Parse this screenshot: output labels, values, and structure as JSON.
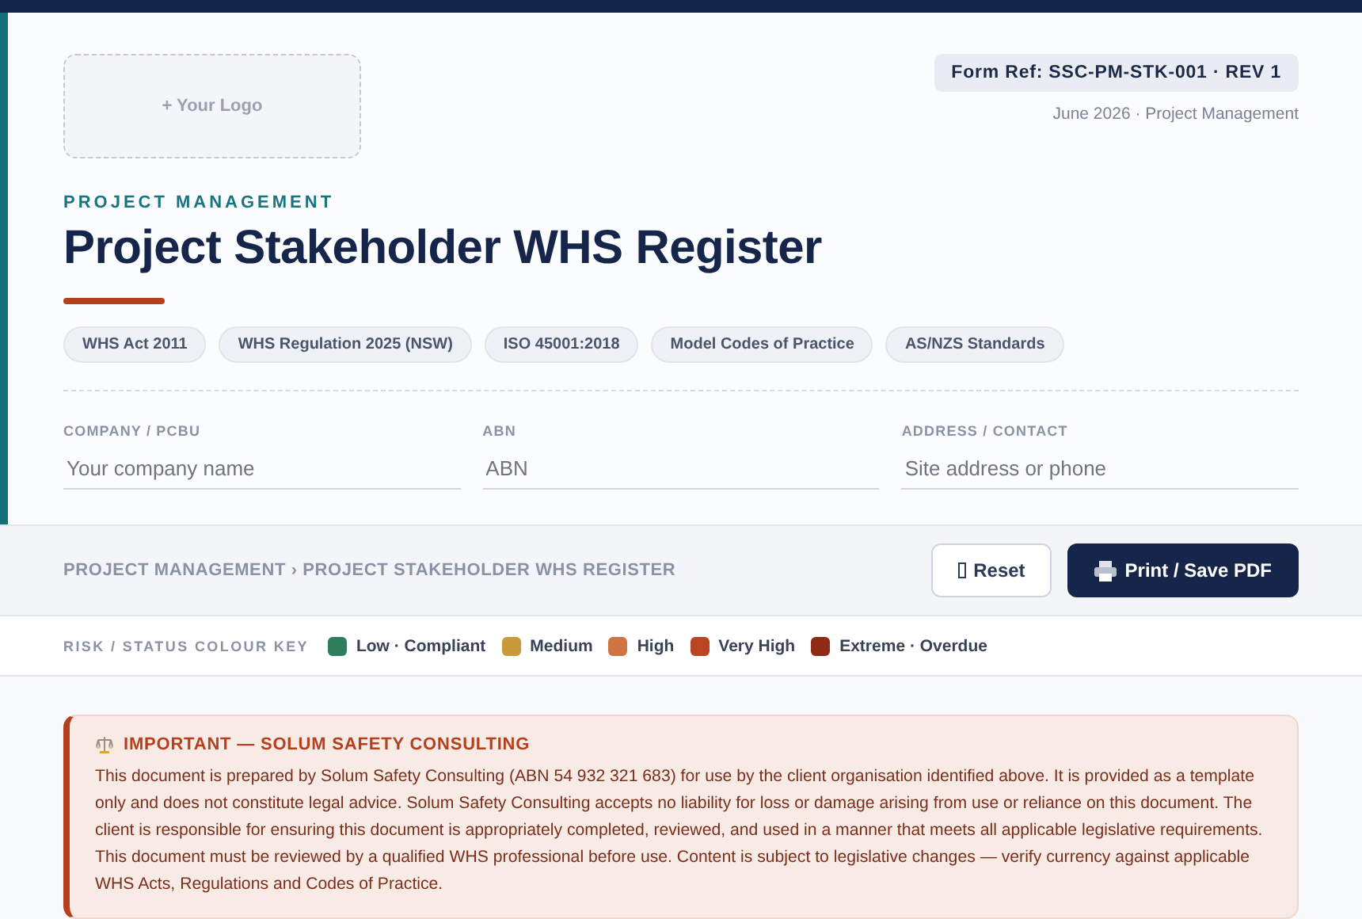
{
  "logo": {
    "label": "+ Your Logo"
  },
  "form_ref": "Form Ref: SSC-PM-STK-001 · REV 1",
  "date_line": "June 2026 · Project Management",
  "eyebrow": "PROJECT MANAGEMENT",
  "title": "Project Stakeholder WHS Register",
  "tags": [
    "WHS Act 2011",
    "WHS Regulation 2025 (NSW)",
    "ISO 45001:2018",
    "Model Codes of Practice",
    "AS/NZS Standards"
  ],
  "fields": [
    {
      "label": "COMPANY / PCBU",
      "placeholder": "Your company name"
    },
    {
      "label": "ABN",
      "placeholder": "ABN"
    },
    {
      "label": "ADDRESS / CONTACT",
      "placeholder": "Site address or phone"
    }
  ],
  "breadcrumb": "PROJECT MANAGEMENT › PROJECT STAKEHOLDER WHS REGISTER",
  "buttons": [
    {
      "kind": "secondary",
      "label": "Reset"
    },
    {
      "kind": "primary",
      "label": "Print / Save PDF"
    }
  ],
  "colour_key": {
    "title": "RISK / STATUS COLOUR KEY",
    "items": [
      {
        "label": "Low · Compliant",
        "color": "#2e7d5b"
      },
      {
        "label": "Medium",
        "color": "#c99a3c"
      },
      {
        "label": "High",
        "color": "#cf7442"
      },
      {
        "label": "Very High",
        "color": "#bb4424"
      },
      {
        "label": "Extreme · Overdue",
        "color": "#8e2a16"
      }
    ]
  },
  "notice": {
    "title": "IMPORTANT — SOLUM SAFETY CONSULTING",
    "body": "This document is prepared by Solum Safety Consulting (ABN 54 932 321 683) for use by the client organisation identified above. It is provided as a template only and does not constitute legal advice. Solum Safety Consulting accepts no liability for loss or damage arising from use or reliance on this document. The client is responsible for ensuring this document is appropriately completed, reviewed, and used in a manner that meets all applicable legislative requirements. This document must be reviewed by a qualified WHS professional before use. Content is subject to legislative changes — verify currency against applicable WHS Acts, Regulations and Codes of Practice."
  }
}
